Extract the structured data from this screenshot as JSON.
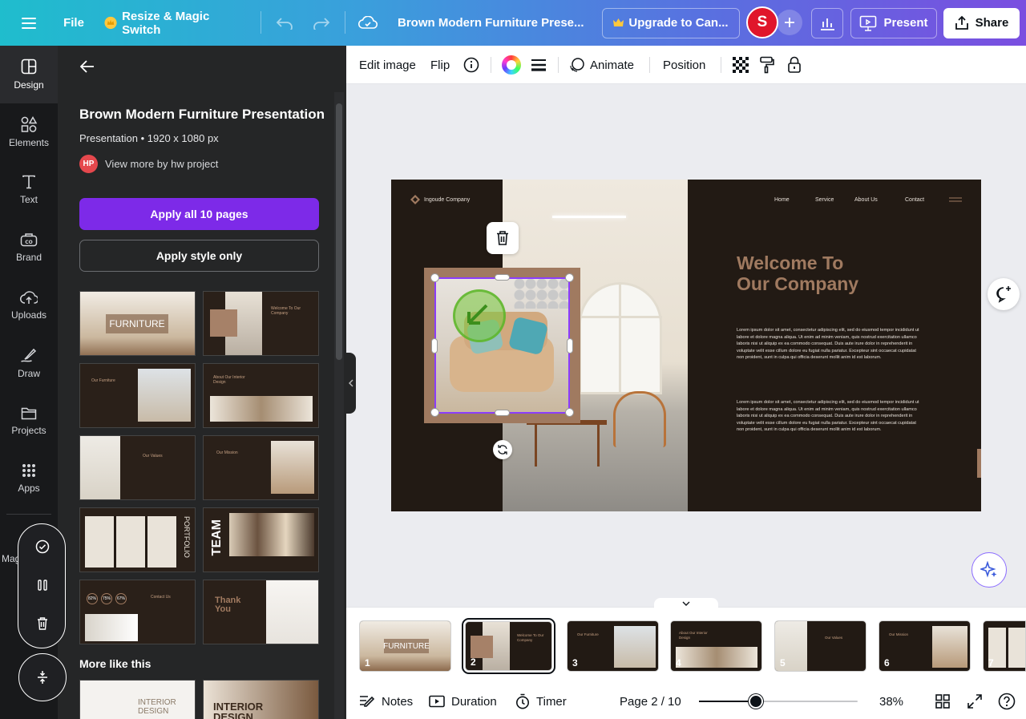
{
  "topbar": {
    "file_label": "File",
    "resize_label": "Resize & Magic Switch",
    "doc_title": "Brown Modern Furniture Prese...",
    "upgrade_label": "Upgrade to Can...",
    "avatar_initial": "S",
    "present_label": "Present",
    "share_label": "Share"
  },
  "rail": {
    "items": [
      {
        "label": "Design",
        "icon": "design-icon"
      },
      {
        "label": "Elements",
        "icon": "elements-icon"
      },
      {
        "label": "Text",
        "icon": "text-icon"
      },
      {
        "label": "Brand",
        "icon": "brand-icon"
      },
      {
        "label": "Uploads",
        "icon": "uploads-icon"
      },
      {
        "label": "Draw",
        "icon": "draw-icon"
      },
      {
        "label": "Projects",
        "icon": "projects-icon"
      },
      {
        "label": "Apps",
        "icon": "apps-icon"
      }
    ],
    "partial_label": "Mag"
  },
  "panel": {
    "title": "Brown Modern Furniture Presentation",
    "meta": "Presentation • 1920 x 1080 px",
    "author_badge": "HP",
    "author_link": "View more by hw project",
    "apply_all_label": "Apply all 10 pages",
    "apply_style_label": "Apply style only",
    "templates": {
      "t1": "FURNITURE",
      "t2": "Welcome To Our Company",
      "t3": "Our Furniture",
      "t4": "About Our Interior Design",
      "t5": "Our Values",
      "t6": "Our Mission",
      "t7": "PORTFOLIO",
      "t8": "TEAM",
      "t9a": "82%",
      "t9b": "75%",
      "t9c": "67%",
      "t9d": "Contact Us",
      "t10": "Thank You"
    },
    "more_title": "More like this",
    "more_items": [
      "INTERIOR DESIGN",
      "INTERIOR DESIGN"
    ]
  },
  "ctxbar": {
    "edit_image": "Edit image",
    "flip": "Flip",
    "animate": "Animate",
    "position": "Position"
  },
  "slide": {
    "brand": "Ingoude Company",
    "nav": [
      "Home",
      "Service",
      "About Us",
      "Contact"
    ],
    "heading_line1": "Welcome To",
    "heading_line2": "Our Company",
    "para1": "Lorem ipsum dolor sit amet, consectetur adipiscing elit, sed do eiusmod tempor incididunt ut labore et dolore magna aliqua. Ut enim ad minim veniam, quis nostrud exercitation ullamco laboris nisi ut aliquip ex ea commodo consequat. Duis aute irure dolor in reprehenderit in voluptate velit esse cillum dolore eu fugiat nulla pariatur. Excepteur sint occaecat cupidatat non proident, sunt in culpa qui officia deserunt mollit anim id est laborum.",
    "para2": "Lorem ipsum dolor sit amet, consectetur adipiscing elit, sed do eiusmod tempor incididunt ut labore et dolore magna aliqua. Ut enim ad minim veniam, quis nostrud exercitation ullamco laboris nisi ut aliquip ex ea commodo consequat. Duis aute irure dolor in reprehenderit in voluptate velit esse cillum dolore eu fugiat nulla pariatur. Excepteur sint occaecat cupidatat non proident, sunt in culpa qui officia deserunt mollit anim id est laborum."
  },
  "filmstrip": {
    "pages": [
      "1",
      "2",
      "3",
      "4",
      "5",
      "6",
      "7"
    ],
    "selected": 2,
    "p1_text": "FURNITURE",
    "p2_text": "Welcome To Our Company",
    "p3_text": "Our Furniture",
    "p4_text": "About Our Interior Design",
    "p5_text": "Our Values",
    "p6_text": "Our Mission"
  },
  "bottombar": {
    "notes": "Notes",
    "duration": "Duration",
    "timer": "Timer",
    "page_indicator": "Page 2 / 10",
    "zoom": "38%",
    "zoom_fraction": 0.36
  },
  "colors": {
    "accent_purple": "#7d2ae8",
    "slide_bg": "#221a14",
    "heading_brown": "#a07a60",
    "selection": "#8b3dff"
  }
}
